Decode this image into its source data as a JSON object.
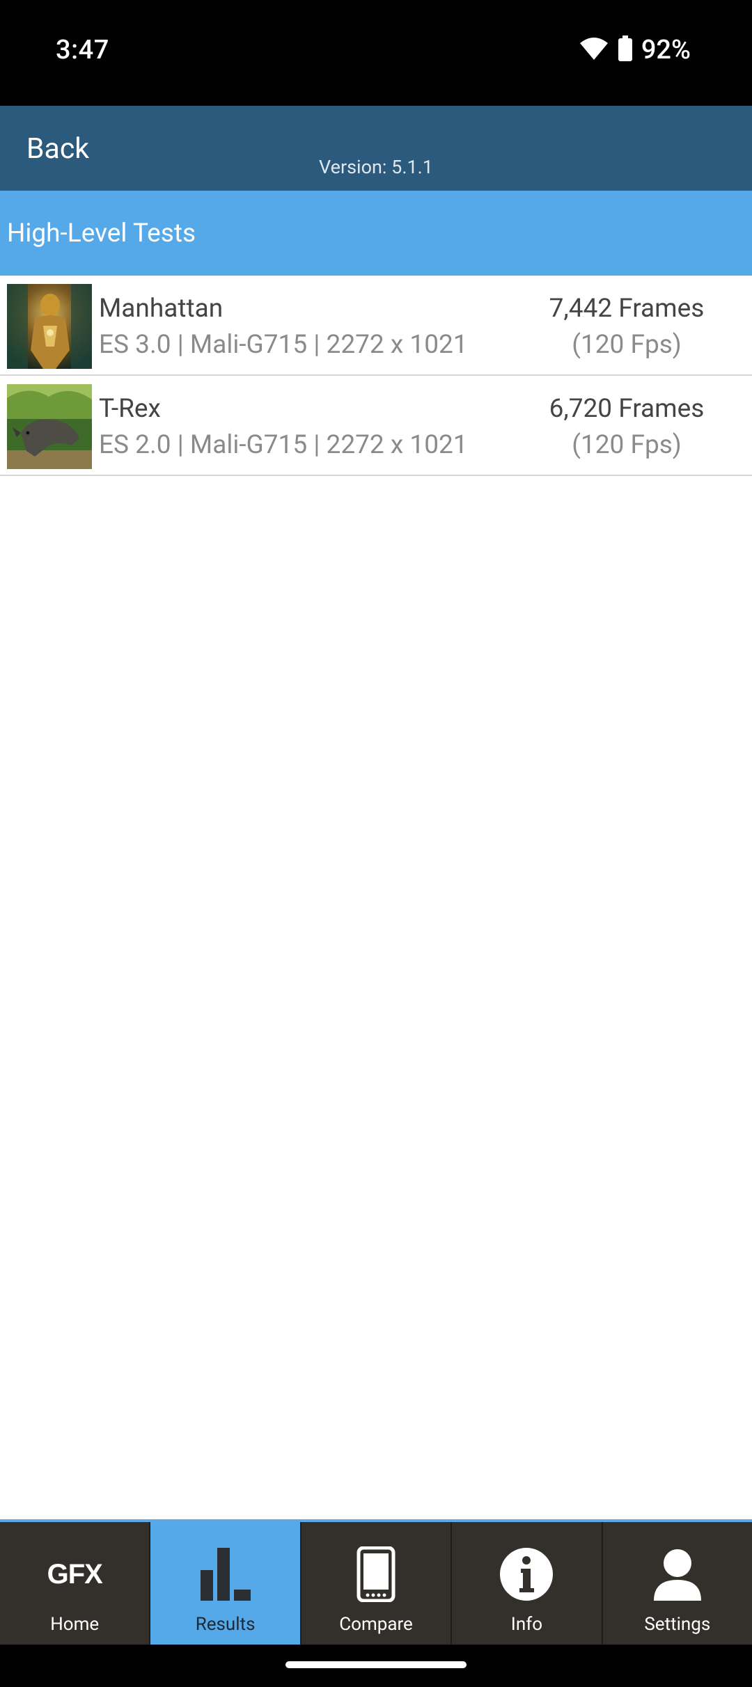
{
  "status_bar": {
    "time": "3:47",
    "battery_percent": "92%",
    "wifi_icon": "wifi-icon",
    "battery_icon": "battery-icon"
  },
  "header": {
    "back_label": "Back",
    "version": "Version: 5.1.1",
    "bg_color": "#2c5a7c"
  },
  "section": {
    "title": "High-Level Tests",
    "bg_color": "#56a9e8"
  },
  "tests": [
    {
      "name": "Manhattan",
      "specs": "ES 3.0 | Mali-G715 | 2272 x 1021",
      "frames": "7,442 Frames",
      "fps": "(120 Fps)"
    },
    {
      "name": "T-Rex",
      "specs": "ES 2.0 | Mali-G715 | 2272 x 1021",
      "frames": "6,720 Frames",
      "fps": "(120 Fps)"
    }
  ],
  "nav": {
    "items": [
      {
        "label": "Home",
        "icon": "gfx-logo-icon",
        "logo_text": "GFX"
      },
      {
        "label": "Results",
        "icon": "bar-chart-icon",
        "active": true
      },
      {
        "label": "Compare",
        "icon": "phone-icon"
      },
      {
        "label": "Info",
        "icon": "info-icon"
      },
      {
        "label": "Settings",
        "icon": "user-icon"
      }
    ],
    "active_color": "#56a9e8",
    "bg_color": "#33302b"
  }
}
